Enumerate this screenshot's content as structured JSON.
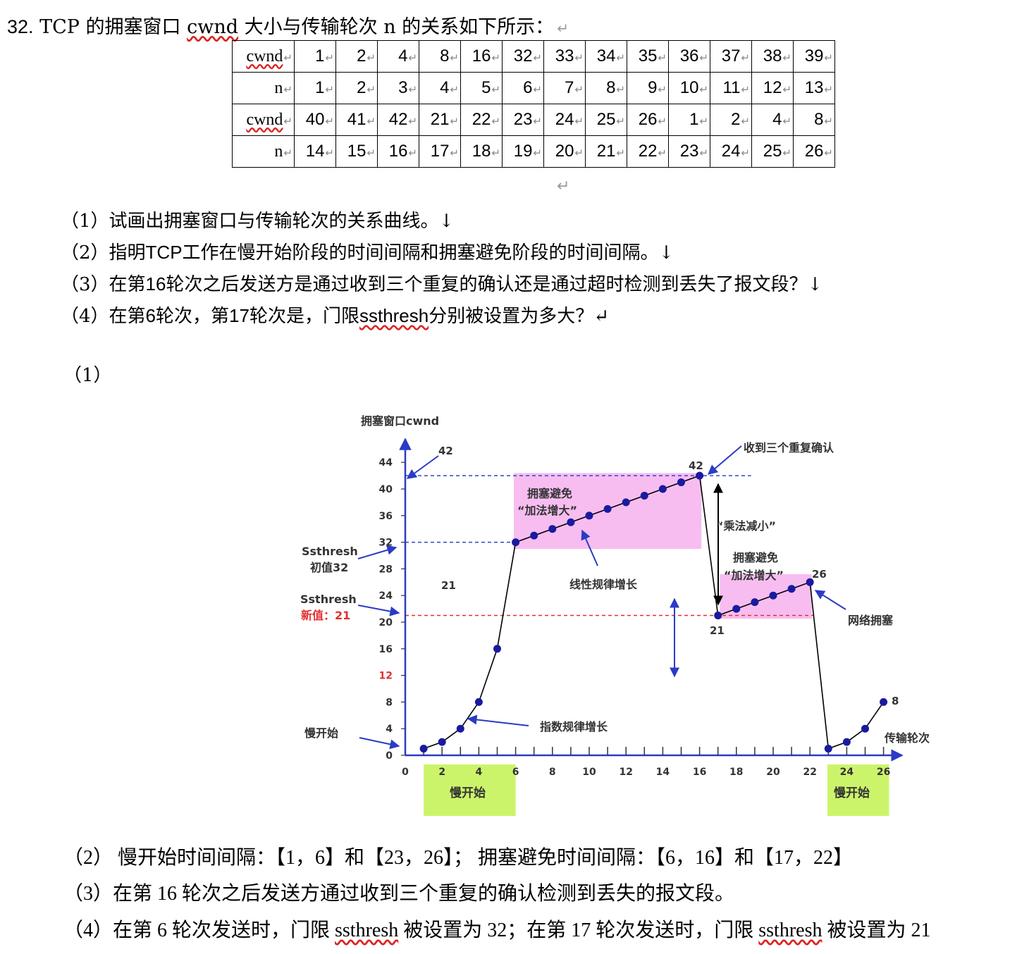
{
  "question": {
    "number": "32.",
    "title_pre": "TCP 的拥塞窗口 ",
    "title_cwnd": "cwnd",
    "title_post": " 大小与传输轮次 n 的关系如下所示：",
    "return_mark": "↵"
  },
  "table": {
    "rows": [
      {
        "label": "cwnd",
        "values": [
          "1",
          "2",
          "4",
          "8",
          "16",
          "32",
          "33",
          "34",
          "35",
          "36",
          "37",
          "38",
          "39"
        ]
      },
      {
        "label": "n",
        "values": [
          "1",
          "2",
          "3",
          "4",
          "5",
          "6",
          "7",
          "8",
          "9",
          "10",
          "11",
          "12",
          "13"
        ]
      },
      {
        "label": "cwnd",
        "values": [
          "40",
          "41",
          "42",
          "21",
          "22",
          "23",
          "24",
          "25",
          "26",
          "1",
          "2",
          "4",
          "8"
        ]
      },
      {
        "label": "n",
        "values": [
          "14",
          "15",
          "16",
          "17",
          "18",
          "19",
          "20",
          "21",
          "22",
          "23",
          "24",
          "25",
          "26"
        ]
      }
    ],
    "cell_mark": "↵"
  },
  "subquestions": {
    "q1": "（1）试画出拥塞窗口与传输轮次的关系曲线。↓",
    "q2_pre": "（2）指明",
    "q2_tcp": "TCP",
    "q2_post": "工作在慢开始阶段的时间间隔和拥塞避免阶段的时间间隔。↓",
    "q3_pre": "（3）在第",
    "q3_num": "16",
    "q3_post": "轮次之后发送方是通过收到三个重复的确认还是通过超时检测到丢失了报文段？↓",
    "q4_pre": "（4）在第",
    "q4_n1": "6",
    "q4_mid1": "轮次，第",
    "q4_n2": "17",
    "q4_mid2": "轮次是，门限",
    "q4_ss": "ssthresh",
    "q4_post": "分别被设置为多大？↵"
  },
  "answer_label": "（1）",
  "chart_data": {
    "type": "line",
    "ylabel": "拥塞窗口cwnd",
    "xlabel": "传输轮次",
    "x_ticks": [
      "0",
      "2",
      "4",
      "6",
      "8",
      "10",
      "12",
      "14",
      "16",
      "18",
      "20",
      "22",
      "24",
      "26"
    ],
    "y_ticks": [
      "0",
      "4",
      "8",
      "12",
      "16",
      "20",
      "24",
      "28",
      "32",
      "36",
      "40",
      "44"
    ],
    "x": [
      1,
      2,
      3,
      4,
      5,
      6,
      7,
      8,
      9,
      10,
      11,
      12,
      13,
      14,
      15,
      16,
      17,
      18,
      19,
      20,
      21,
      22,
      23,
      24,
      25,
      26
    ],
    "values": [
      1,
      2,
      4,
      8,
      16,
      32,
      33,
      34,
      35,
      36,
      37,
      38,
      39,
      40,
      41,
      42,
      21,
      22,
      23,
      24,
      25,
      26,
      1,
      2,
      4,
      8
    ],
    "xlim": [
      0,
      27
    ],
    "ylim": [
      0,
      46
    ],
    "threshold_lines": [
      42,
      32,
      21
    ],
    "annotations": {
      "peak_arrow": "42",
      "peak": "42",
      "three_dup": "收到三个重复确认",
      "ca1_line1": "拥塞避免",
      "ca1_line2": "“加法增大”",
      "mult_dec": "“乘法减小”",
      "ca2_line1": "拥塞避免",
      "ca2_line2": "“加法增大”",
      "peak2": "26",
      "linear": "线性规律增长",
      "ssthresh_init_1": "Ssthresh",
      "ssthresh_init_2": "初值32",
      "ssthresh_new_1": "Ssthresh",
      "ssthresh_new_2": "新值：21",
      "label_21_left": "21",
      "label_21_point": "21",
      "congestion": "网络拥塞",
      "exp": "指数规律增长",
      "slow_start_left": "慢开始",
      "slow_start_box1": "慢开始",
      "slow_start_box2": "慢开始",
      "end_label": "8"
    },
    "colors": {
      "line": "#000000",
      "point": "#1a1aa0",
      "arrow": "#2b3bc4",
      "dashed_blue": "#3344cc",
      "dashed_red": "#e03030",
      "pink": "#f7bdf0",
      "green": "#ccf46a",
      "red_tick": "#e03030"
    }
  },
  "answers": {
    "a2_pre": "（2）  慢开始时间间隔：【1，6】和【23，26】；  拥塞避免时间间隔：【6，16】和【17，22】",
    "a3": "（3）在第 16 轮次之后发送方通过收到三个重复的确认检测到丢失的报文段。",
    "a4_1": "（4）在第 6 轮次发送时，门限 ",
    "a4_ss1": "ssthresh",
    "a4_2": " 被设置为 32；在第 17 轮次发送时，门限 ",
    "a4_ss2": "ssthresh",
    "a4_3": " 被设置为 21"
  }
}
